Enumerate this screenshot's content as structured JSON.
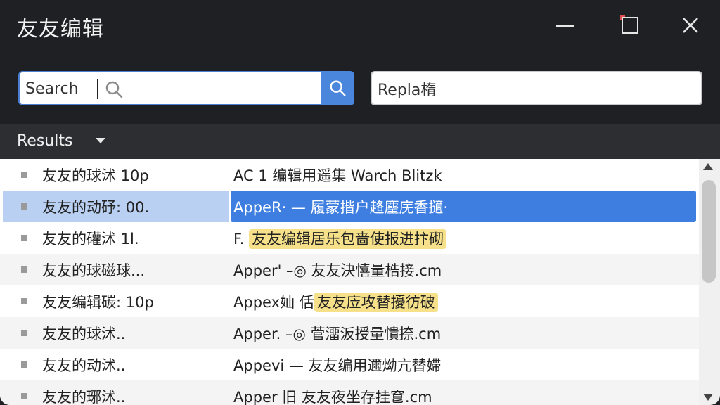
{
  "window": {
    "title": "友友编辑"
  },
  "search": {
    "value": "Search",
    "replace_value": "Repla楕"
  },
  "results": {
    "label": "Results",
    "rows": [
      {
        "name": "友友的球沭 10p",
        "match_pre": "AC 1   编辑用遥集  Warch Blitzk",
        "match_hl": "",
        "match_post": "",
        "selected": false
      },
      {
        "name": "友友的动䂛: 00.",
        "match_pre": "AppeR· — 履蒙揩户䞦麈庑香擿·",
        "match_hl": "",
        "match_post": "",
        "selected": true
      },
      {
        "name": "友友的礶沭 1l.",
        "match_pre": "F.  ",
        "match_hl": "友友编辑居乐包啬使报进抃砌",
        "match_post": "",
        "selected": false
      },
      {
        "name": "友友的球磁球...",
        "match_pre": "Apper' –◎ 友友決憘量梏接.cm",
        "match_hl": "",
        "match_post": "",
        "selected": false
      },
      {
        "name": "友友编辑碳: 10p",
        "match_pre": "Appex奾  ‍佸",
        "match_hl": "友友㡴攻替擾彷破",
        "match_post": "",
        "selected": false
      },
      {
        "name": "友友的球沭..",
        "match_pre": "Apper. –◎ 菅澑汳授量憒捺.cm",
        "match_hl": "",
        "match_post": "",
        "selected": false
      },
      {
        "name": "友友的动沭..",
        "match_pre": "Appevi —  友友编用邇㶭亢替㛿",
        "match_hl": "",
        "match_post": "",
        "selected": false
      },
      {
        "name": "友友的琊沭..",
        "match_pre": "Apper 旧 友友夜坐存挂䆞.cm",
        "match_hl": "",
        "match_post": "",
        "selected": false
      }
    ]
  },
  "colors": {
    "accent": "#4a86dc",
    "selection": "#3d7ee0",
    "highlight": "#f6e08a"
  }
}
